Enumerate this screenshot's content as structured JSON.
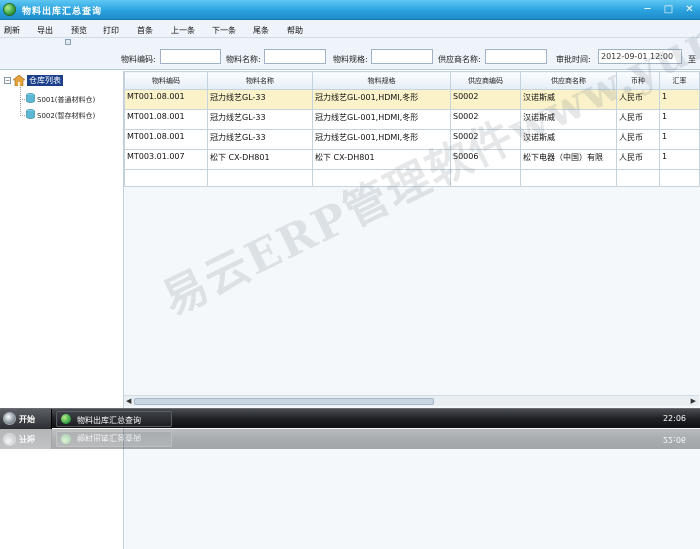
{
  "window": {
    "title": "物料出库汇总查询",
    "minimize": "─",
    "maximize": "□",
    "close": "✕"
  },
  "menu": [
    "刷新",
    "导出",
    "预览",
    "打印",
    "首条",
    "上一条",
    "下一条",
    "尾条",
    "帮助"
  ],
  "search": {
    "material_code_label": "物料编码:",
    "material_code_value": "",
    "material_name_label": "物料名称:",
    "material_name_value": "",
    "material_spec_label": "物料规格:",
    "material_spec_value": "",
    "supplier_name_label": "供应商名称:",
    "supplier_name_value": "",
    "approval_time_label": "审批时间:",
    "approval_time_value": "2012-09-01 12:00",
    "to_label": "至"
  },
  "tree": {
    "root_label": "仓库列表",
    "children": [
      "S001(普通材料仓)",
      "S002(暂存材料仓)"
    ]
  },
  "grid": {
    "columns": [
      "物料编码",
      "物料名称",
      "物料规格",
      "供应商编码",
      "供应商名称",
      "币种",
      "汇率"
    ],
    "rows": [
      [
        "MT001.08.001",
        "冠力线艺GL-33",
        "冠力线艺GL-001,HDMI,冬形",
        "S0002",
        "汉诺斯威",
        "人民币",
        "1"
      ],
      [
        "MT001.08.001",
        "冠力线艺GL-33",
        "冠力线艺GL-001,HDMI,冬形",
        "S0002",
        "汉诺斯威",
        "人民币",
        "1"
      ],
      [
        "MT001.08.001",
        "冠力线艺GL-33",
        "冠力线艺GL-001,HDMI,冬形",
        "S0002",
        "汉诺斯威",
        "人民币",
        "1"
      ],
      [
        "MT003.01.007",
        "松下  CX-DH801",
        "松下  CX-DH801",
        "S0006",
        "松下电器（中国）有限",
        "人民币",
        "1"
      ]
    ]
  },
  "taskbar": {
    "start_label": "开始",
    "task_label": "物料出库汇总查询",
    "clock": "22:06"
  },
  "watermark": "易云ERP管理软件www.yunerp.com"
}
